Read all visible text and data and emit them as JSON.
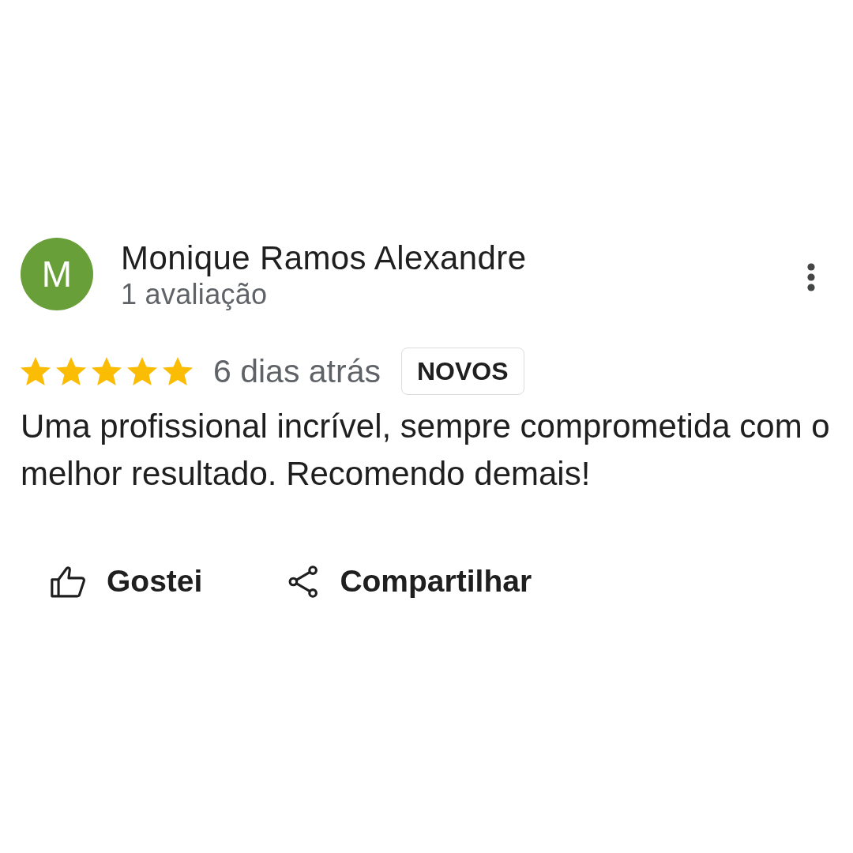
{
  "review": {
    "avatar_initial": "M",
    "author": "Monique Ramos Alexandre",
    "author_meta": "1 avaliação",
    "stars": 5,
    "time": "6 dias atrás",
    "badge": "NOVOS",
    "text": "Uma profissional incrível, sempre comprometida com o melhor resultado. Recomendo demais!",
    "actions": [
      {
        "kind": "like",
        "label": "Gostei"
      },
      {
        "kind": "share",
        "label": "Compartilhar"
      }
    ]
  }
}
